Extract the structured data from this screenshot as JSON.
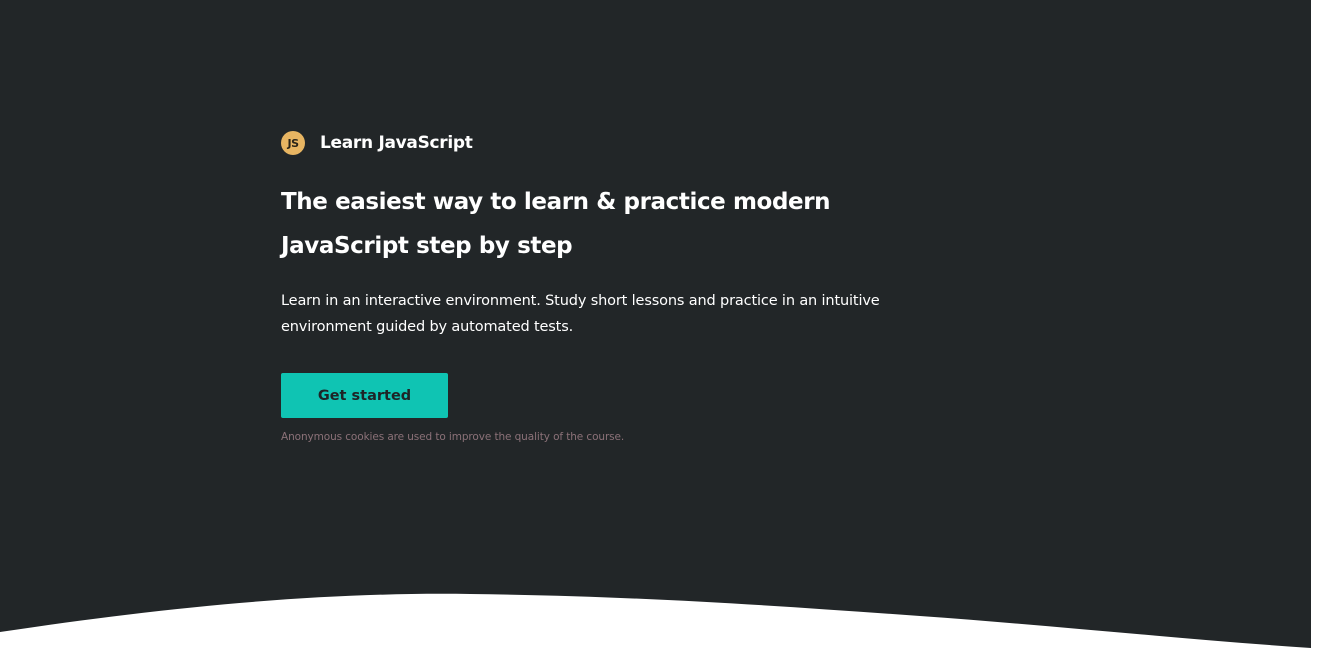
{
  "brand": {
    "logo_text": "JS",
    "logo_icon": "js-logo-icon",
    "name": "Learn JavaScript"
  },
  "hero": {
    "headline": "The easiest way to learn & practice modern JavaScript step by step",
    "lead": "Learn in an interactive environment. Study short lessons and practice in an intuitive environment guided by automated tests.",
    "cta_label": "Get started",
    "cookie_note": "Anonymous cookies are used to improve the quality of the course."
  },
  "colors": {
    "background": "#222628",
    "accent": "#0fc4b3",
    "logo": "#e8b562",
    "note": "#8b7178"
  }
}
